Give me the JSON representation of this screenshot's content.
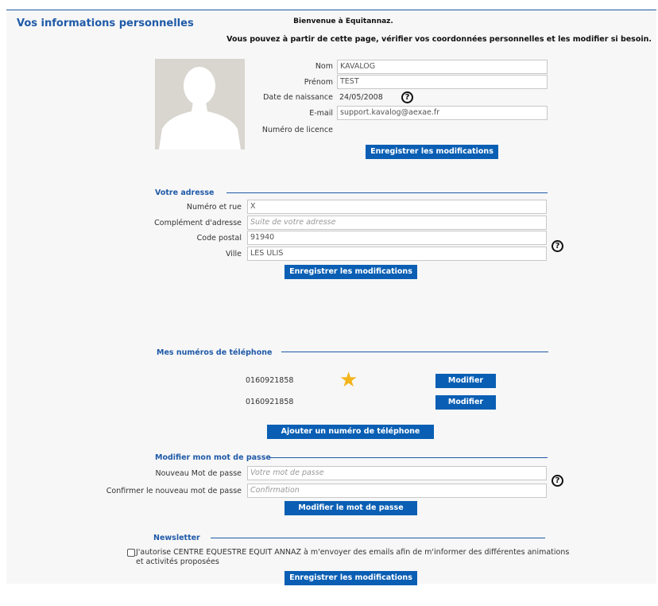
{
  "header": {
    "title": "Vos informations personnelles",
    "welcome": "Bienvenue à Equitannaz.",
    "intro": "Vous pouvez à partir de cette page, vérifier vos coordonnées personnelles et les modifier si besoin."
  },
  "identity": {
    "nom_label": "Nom",
    "nom_value": "KAVALOG",
    "prenom_label": "Prénom",
    "prenom_value": "TEST",
    "dob_label": "Date de naissance",
    "dob_value": "24/05/2008",
    "email_label": "E-mail",
    "email_value": "support.kavalog@aexae.fr",
    "licence_label": "Numéro de licence",
    "save_label": "Enregistrer les modifications"
  },
  "address": {
    "section_title": "Votre adresse",
    "street_label": "Numéro et rue",
    "street_value": "X",
    "complement_label": "Complément d'adresse",
    "complement_placeholder": "Suite de votre adresse",
    "postal_label": "Code postal",
    "postal_value": "91940",
    "city_label": "Ville",
    "city_value": "LES ULIS",
    "save_label": "Enregistrer les modifications"
  },
  "phones": {
    "section_title": "Mes numéros de téléphone",
    "items": [
      {
        "number": "0160921858",
        "modify_label": "Modifier",
        "favorite": true
      },
      {
        "number": "0160921858",
        "modify_label": "Modifier",
        "favorite": false
      }
    ],
    "add_label": "Ajouter un numéro de téléphone"
  },
  "password": {
    "section_title": "Modifier mon mot de passe",
    "new_label": "Nouveau Mot de passe",
    "new_placeholder": "Votre mot de passe",
    "confirm_label": "Confirmer le nouveau mot de passe",
    "confirm_placeholder": "Confirmation",
    "submit_label": "Modifier le mot de passe"
  },
  "newsletter": {
    "section_title": "Newsletter",
    "consent_text": "J'autorise CENTRE EQUESTRE EQUIT ANNAZ à m'envoyer des emails afin de m'informer des différentes animations et activités proposées",
    "checked": false,
    "save_label": "Enregistrer les modifications"
  },
  "icons": {
    "help": "?",
    "star": "★",
    "colors": {
      "accent": "#0a5fb4",
      "title": "#1f5aa8",
      "star": "#f2b41a"
    }
  }
}
